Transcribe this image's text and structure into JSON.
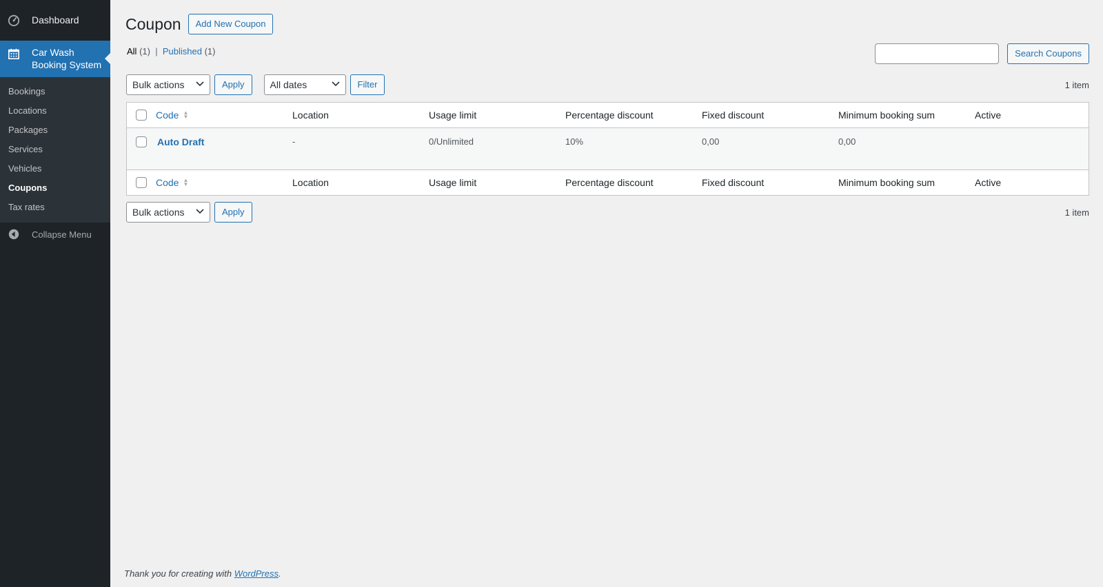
{
  "sidebar": {
    "dashboard": "Dashboard",
    "current_menu": "Car Wash Booking System",
    "current_menu_line1": "Car Wash",
    "current_menu_line2": "Booking System",
    "items": [
      {
        "label": "Bookings"
      },
      {
        "label": "Locations"
      },
      {
        "label": "Packages"
      },
      {
        "label": "Services"
      },
      {
        "label": "Vehicles"
      },
      {
        "label": "Coupons",
        "current": true
      },
      {
        "label": "Tax rates"
      }
    ],
    "collapse": "Collapse Menu"
  },
  "page": {
    "title": "Coupon",
    "add_new": "Add New Coupon",
    "views": {
      "all_label": "All",
      "all_count": "(1)",
      "separator": "|",
      "published_label": "Published",
      "published_count": "(1)"
    },
    "search": {
      "value": "",
      "button": "Search Coupons"
    }
  },
  "tablenav_top": {
    "bulk_select": "Bulk actions",
    "apply": "Apply",
    "date_select": "All dates",
    "filter": "Filter",
    "count": "1 item"
  },
  "table": {
    "columns": [
      "Code",
      "Location",
      "Usage limit",
      "Percentage discount",
      "Fixed discount",
      "Minimum booking sum",
      "Active"
    ],
    "rows": [
      {
        "code": "Auto Draft",
        "location": "-",
        "usage_limit": "0/Unlimited",
        "percentage_discount": "10%",
        "fixed_discount": "0,00",
        "minimum_booking_sum": "0,00",
        "active": ""
      }
    ]
  },
  "tablenav_bottom": {
    "bulk_select": "Bulk actions",
    "apply": "Apply",
    "count": "1 item"
  },
  "footer": {
    "text": "Thank you for creating with",
    "link": "WordPress",
    "end": "."
  },
  "colors": {
    "sidebar_bg": "#1d2327",
    "accent": "#2271b1",
    "page_bg": "#f0f0f1"
  }
}
